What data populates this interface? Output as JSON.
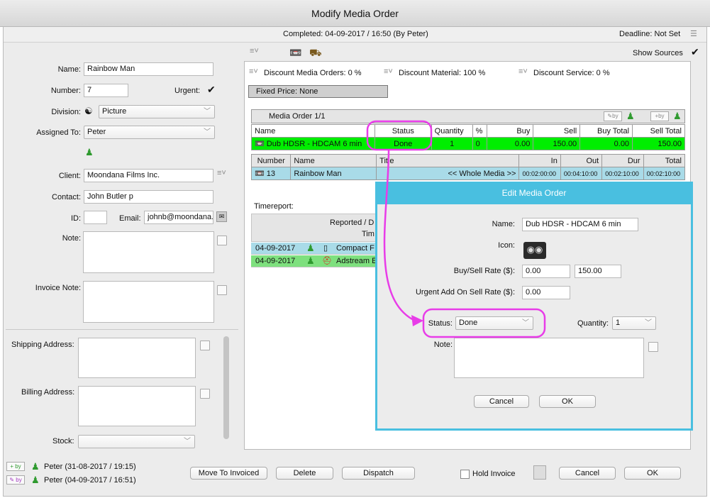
{
  "window": {
    "title": "Modify Media Order"
  },
  "infobar": {
    "completed": "Completed: 04-09-2017 / 16:50 (By Peter)",
    "deadline": "Deadline: Not Set"
  },
  "left": {
    "name_label": "Name:",
    "name_value": "Rainbow Man",
    "number_label": "Number:",
    "number_value": "7",
    "urgent_label": "Urgent:",
    "division_label": "Division:",
    "division_value": "Picture",
    "assigned_label": "Assigned To:",
    "assigned_value": "Peter",
    "client_label": "Client:",
    "client_value": "Moondana Films Inc.",
    "contact_label": "Contact:",
    "contact_value": "John Butler p",
    "id_label": "ID:",
    "email_label": "Email:",
    "email_value": "johnb@moondana.",
    "note_label": "Note:",
    "invoice_note_label": "Invoice Note:",
    "shipping_label": "Shipping Address:",
    "billing_label": "Billing Address:",
    "stock_label": "Stock:"
  },
  "history": [
    {
      "badge": "+ by",
      "text": "Peter (31-08-2017 / 19:15)"
    },
    {
      "badge": "✎ by",
      "text": "Peter (04-09-2017 / 16:51)"
    }
  ],
  "right": {
    "show_sources": "Show Sources",
    "discount_orders": "Discount Media Orders: 0 %",
    "discount_material": "Discount Material: 100 %",
    "discount_service": "Discount Service: 0 %",
    "fixed_price": "Fixed Price: None",
    "media_order_title": "Media Order 1/1",
    "by_label": "by",
    "columns": [
      "Name",
      "Status",
      "Quantity",
      "%",
      "Buy",
      "Sell",
      "Buy Total",
      "Sell Total"
    ],
    "order_row": {
      "name": "Dub HDSR - HDCAM 6 min",
      "status": "Done",
      "quantity": "1",
      "pct": "0",
      "buy": "0.00",
      "sell": "150.00",
      "buy_total": "0.00",
      "sell_total": "150.00"
    },
    "sub_columns": [
      "Number",
      "Name",
      "Title",
      "In",
      "Out",
      "Dur",
      "Total"
    ],
    "sub_row": {
      "number": "13",
      "name": "Rainbow Man",
      "title": "<< Whole Media >>",
      "in": "00:02:00:00",
      "out": "00:04:10:00",
      "dur": "00:02:10:00",
      "total": "00:02:10:00"
    },
    "timereport_label": "Timereport:",
    "timereport_header1": "Reported / D",
    "timereport_header2": "Tim",
    "timereport_rows": [
      {
        "date": "04-09-2017",
        "text": "Compact F"
      },
      {
        "date": "04-09-2017",
        "text": "Adstream E"
      }
    ]
  },
  "dialog": {
    "title": "Edit Media Order",
    "name_label": "Name:",
    "name_value": "Dub HDSR - HDCAM 6 min",
    "icon_label": "Icon:",
    "rate_label": "Buy/Sell Rate ($):",
    "buy_rate": "0.00",
    "sell_rate": "150.00",
    "urgent_label": "Urgent Add On Sell Rate ($):",
    "urgent_value": "0.00",
    "status_label": "Status:",
    "status_value": "Done",
    "quantity_label": "Quantity:",
    "quantity_value": "1",
    "note_label": "Note:",
    "cancel": "Cancel",
    "ok": "OK"
  },
  "footer": {
    "move_to_invoiced": "Move To Invoiced",
    "delete": "Delete",
    "dispatch": "Dispatch",
    "hold_invoice": "Hold Invoice",
    "cancel": "Cancel",
    "ok": "OK"
  },
  "colors": {
    "highlight_green": "#00ee00",
    "row_blue": "#a9dbe8",
    "dialog_accent": "#49bfe0",
    "annotation": "#e83ce8"
  }
}
